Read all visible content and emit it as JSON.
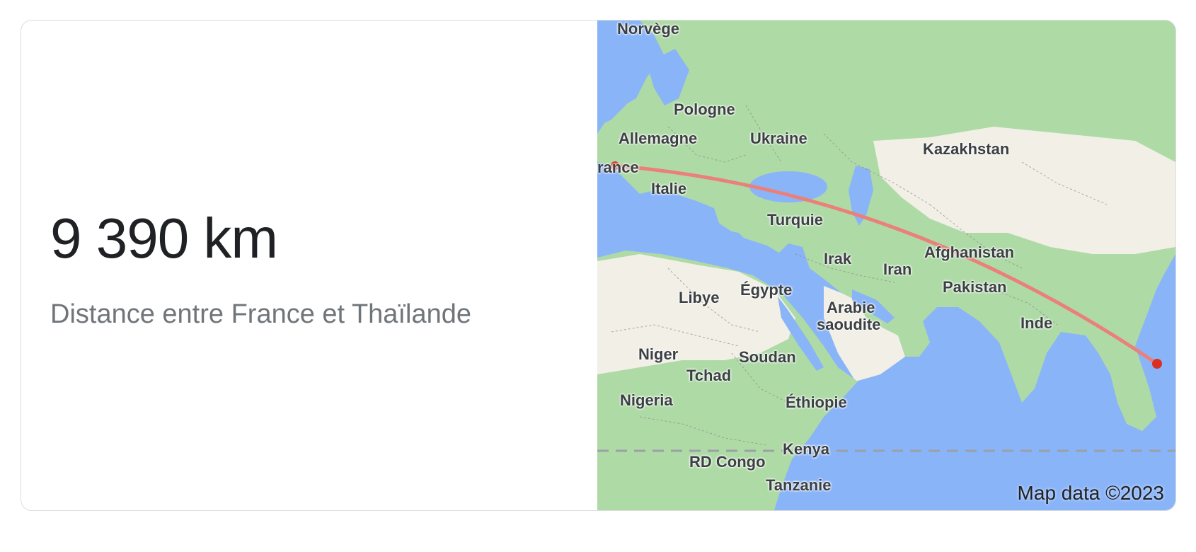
{
  "result": {
    "distance": "9 390 km",
    "caption": "Distance entre France et Thaïlande"
  },
  "map": {
    "attribution": "Map data ©2023",
    "route_color": "#ea8079",
    "marker_color": "#d93025",
    "labels": {
      "norvege": "Norvège",
      "pologne": "Pologne",
      "allemagne": "Allemagne",
      "ukraine": "Ukraine",
      "kazakhstan": "Kazakhstan",
      "france": "rance",
      "italie": "Italie",
      "turquie": "Turquie",
      "afghanistan": "Afghanistan",
      "irak": "Irak",
      "iran": "Iran",
      "pakistan": "Pakistan",
      "libye": "Libye",
      "egypte": "Égypte",
      "arabie": "Arabie",
      "saoudite": "saoudite",
      "inde": "Inde",
      "niger": "Niger",
      "soudan": "Soudan",
      "tchad": "Tchad",
      "nigeria": "Nigeria",
      "ethiopie": "Éthiopie",
      "kenya": "Kenya",
      "rdcongo": "RD Congo",
      "tanzanie": "Tanzanie"
    }
  }
}
